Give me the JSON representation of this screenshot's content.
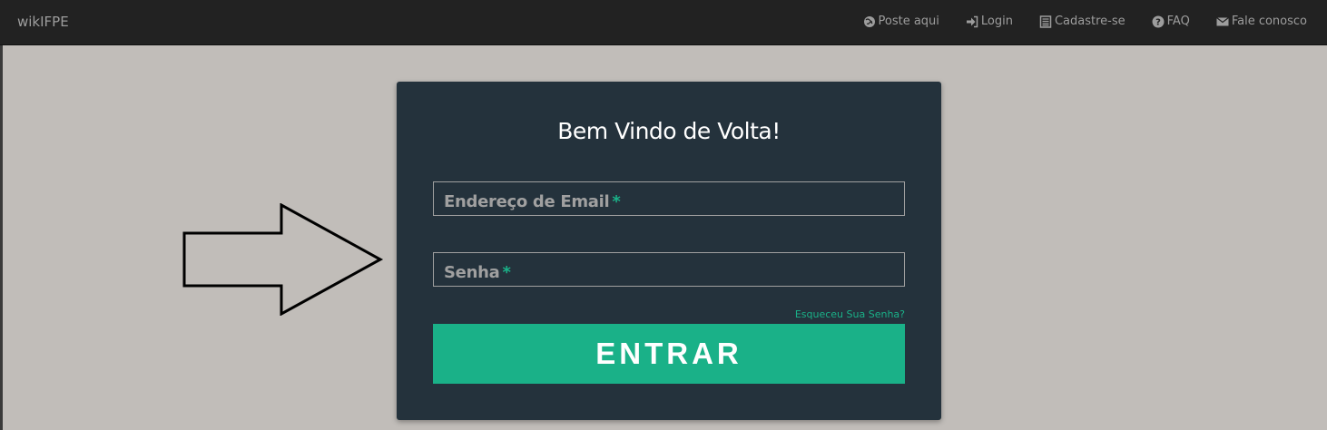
{
  "navbar": {
    "brand": "wikIFPE",
    "links": [
      {
        "label": "Poste aqui",
        "icon": "globe-icon"
      },
      {
        "label": "Login",
        "icon": "sign-in-icon"
      },
      {
        "label": "Cadastre-se",
        "icon": "list-alt-icon"
      },
      {
        "label": "FAQ",
        "icon": "question-circle-icon"
      },
      {
        "label": "Fale conosco",
        "icon": "envelope-icon"
      }
    ]
  },
  "login": {
    "title": "Bem Vindo de Volta!",
    "email_placeholder": "Endereço de Email",
    "password_placeholder": "Senha",
    "required_mark": "*",
    "forgot_label": "Esqueceu Sua Senha?",
    "submit_label": "ENTRAR"
  },
  "annotation": {
    "icon": "arrow-right-icon"
  },
  "colors": {
    "navbar_bg": "#222222",
    "page_bg": "#c1bdb9",
    "card_bg": "#24323c",
    "accent": "#1ab188",
    "muted_text": "#9d9d9d"
  }
}
